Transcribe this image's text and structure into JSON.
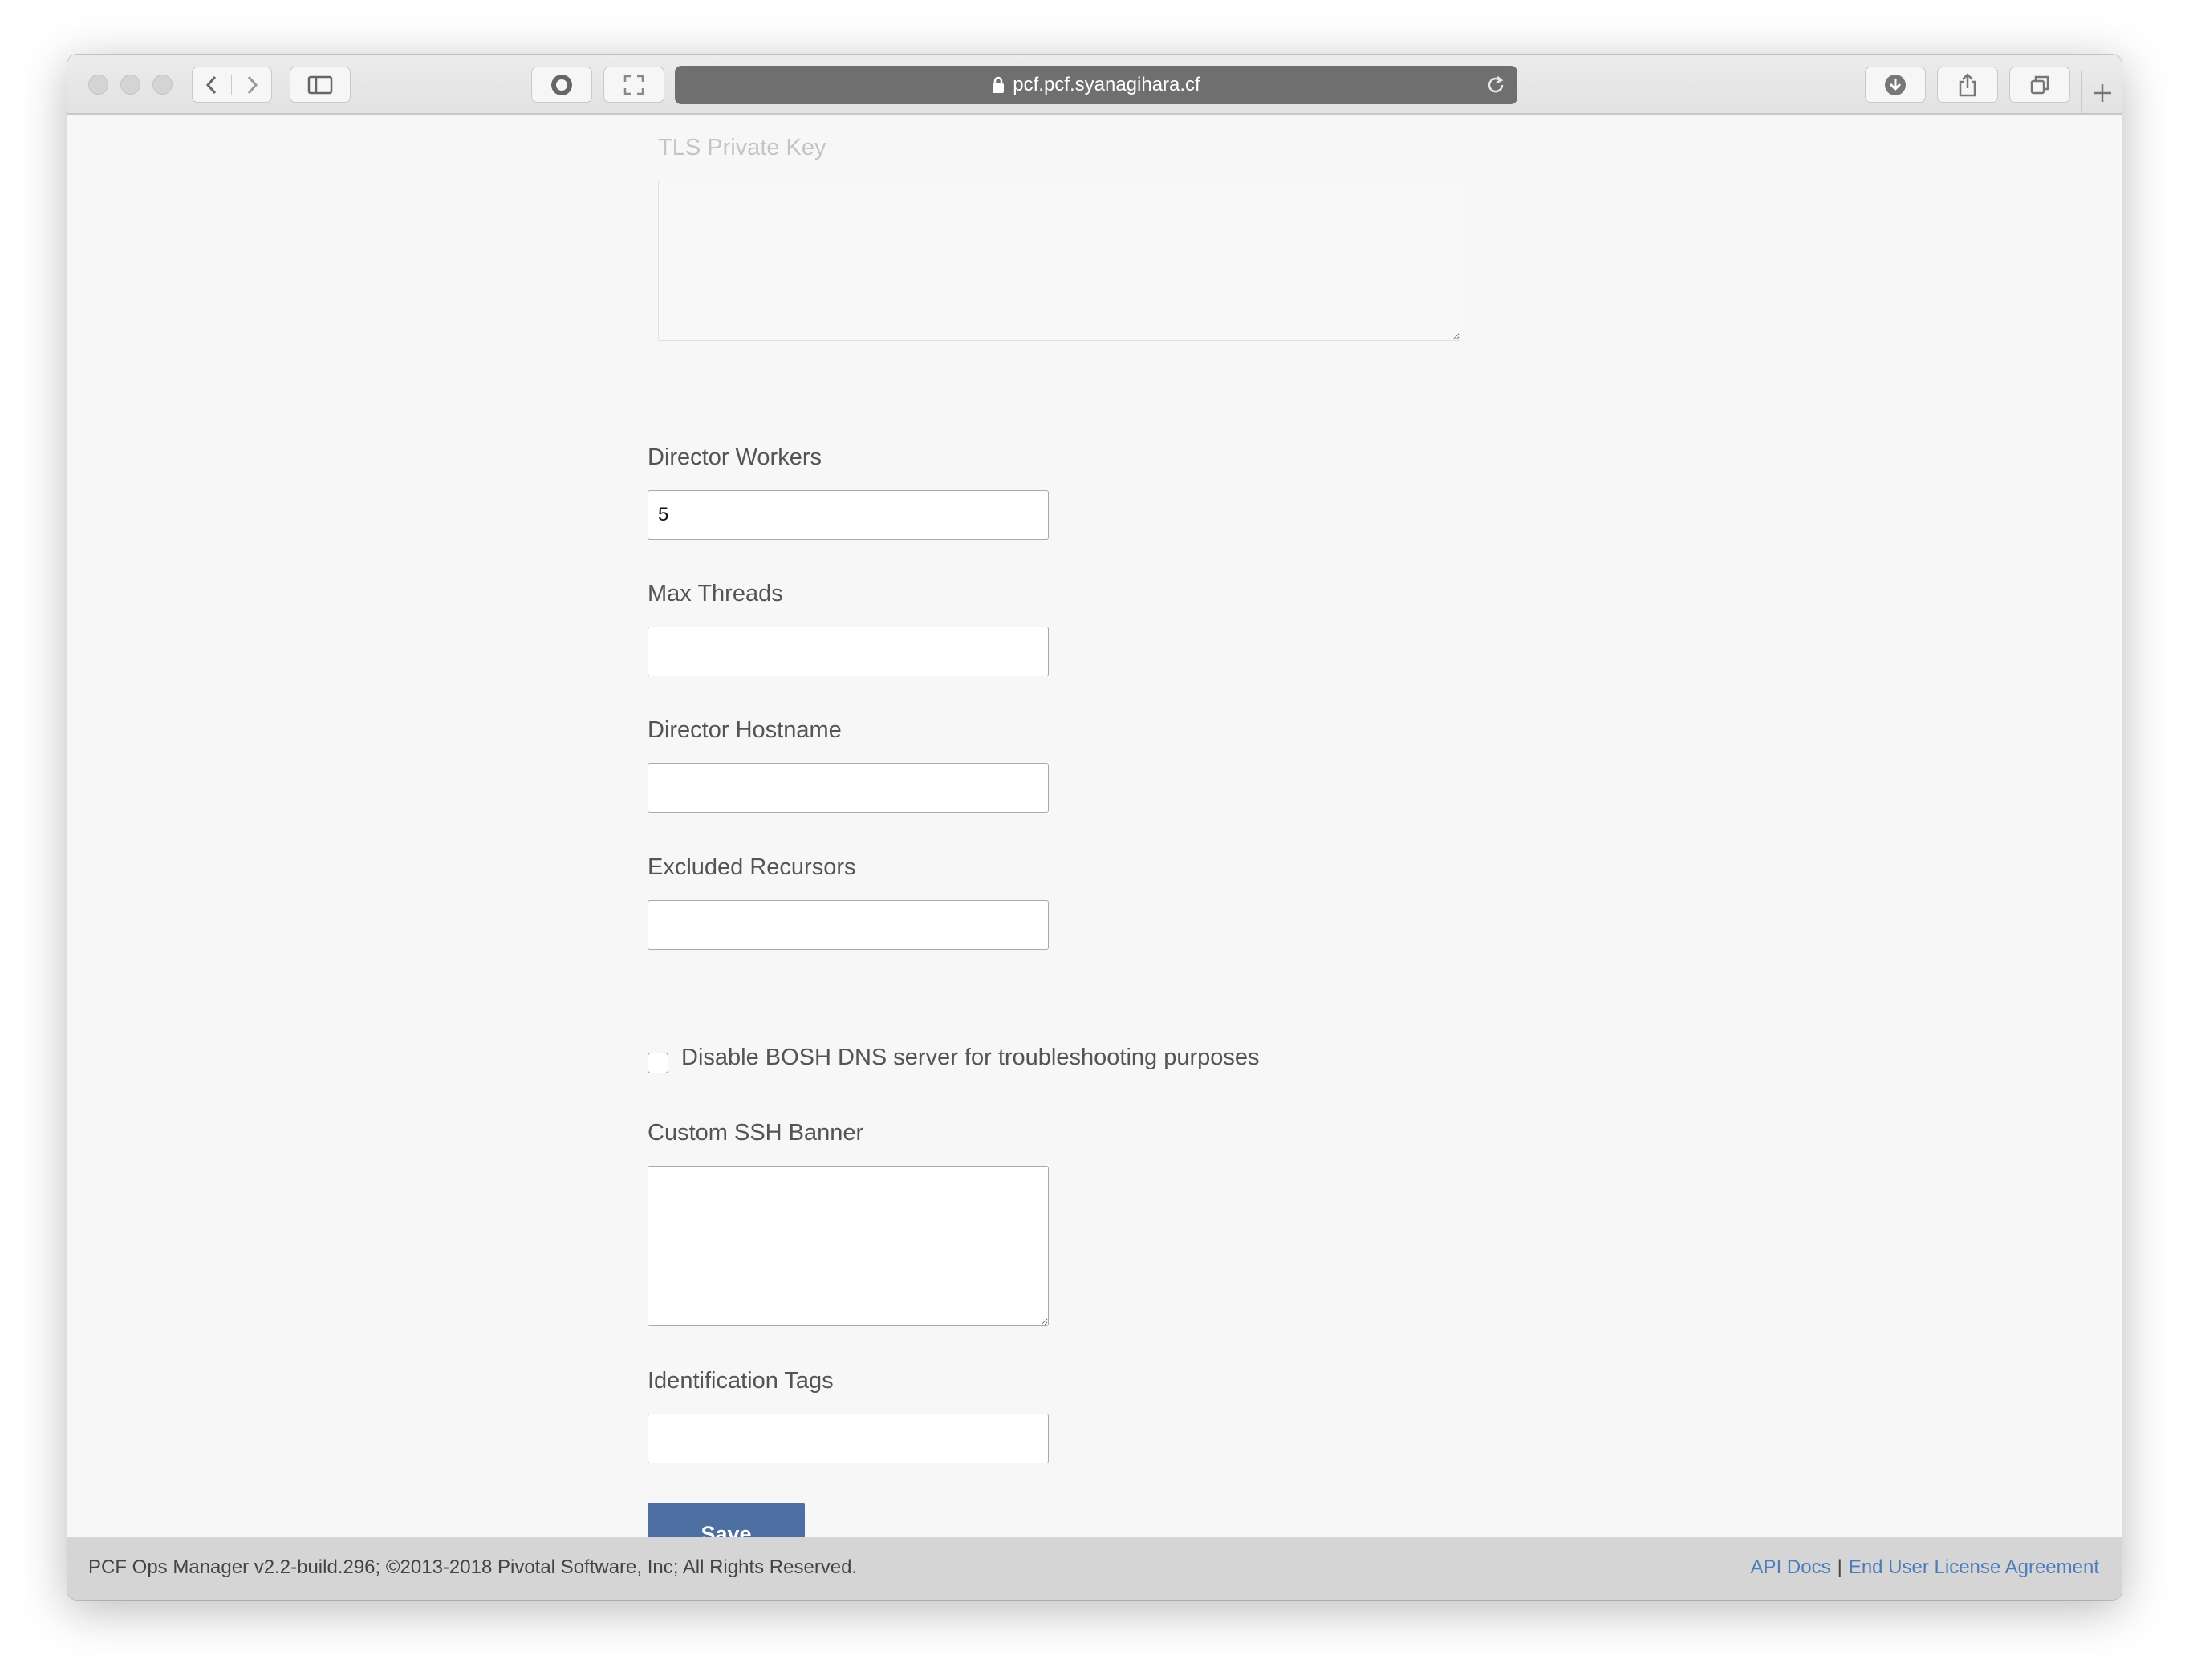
{
  "browser": {
    "url": "pcf.pcf.syanagihara.cf"
  },
  "form": {
    "tls_private_key": {
      "label": "TLS Private Key",
      "value": ""
    },
    "director_workers": {
      "label": "Director Workers",
      "value": "5"
    },
    "max_threads": {
      "label": "Max Threads",
      "value": ""
    },
    "director_hostname": {
      "label": "Director Hostname",
      "value": ""
    },
    "excluded_recursors": {
      "label": "Excluded Recursors",
      "value": ""
    },
    "disable_bosh_dns": {
      "label": "Disable BOSH DNS server for troubleshooting purposes",
      "checked": false
    },
    "custom_ssh_banner": {
      "label": "Custom SSH Banner",
      "value": ""
    },
    "identification_tags": {
      "label": "Identification Tags",
      "value": ""
    },
    "save_label": "Save"
  },
  "footer": {
    "copyright": "PCF Ops Manager v2.2-build.296; ©2013-2018 Pivotal Software, Inc; All Rights Reserved.",
    "api_docs": "API Docs",
    "separator": "|",
    "eula": "End User License Agreement"
  },
  "colors": {
    "accent": "#4d6fa1",
    "link": "#4d7bbd",
    "page_bg": "#f7f7f7",
    "footer_bg": "#d5d5d5"
  }
}
